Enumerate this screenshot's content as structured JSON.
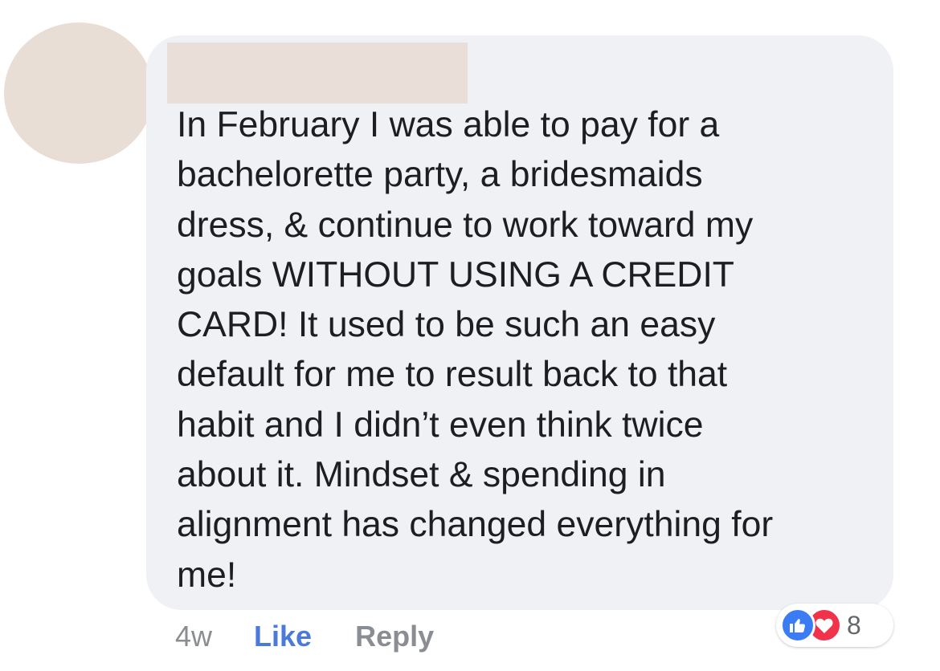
{
  "comment": {
    "text": "In February I was able to pay for a\nbachelorette party, a bridesmaids\ndress, & continue to work toward my\ngoals WITHOUT USING A CREDIT\nCARD! It used to be such an easy\ndefault for me to result back to that\nhabit and I didn’t even think twice\nabout it. Mindset & spending in\nalignment has changed everything for\nme!"
  },
  "actions": {
    "timestamp": "4w",
    "like_label": "Like",
    "reply_label": "Reply"
  },
  "reactions": {
    "icons": [
      "like-icon",
      "love-icon"
    ],
    "count": "8"
  },
  "colors": {
    "bubble": "#f0f1f4",
    "like_link": "#4b7bd8",
    "like_reaction": "#3b7cf5",
    "love_reaction": "#f0324b",
    "redaction": "#e9dfd8"
  }
}
